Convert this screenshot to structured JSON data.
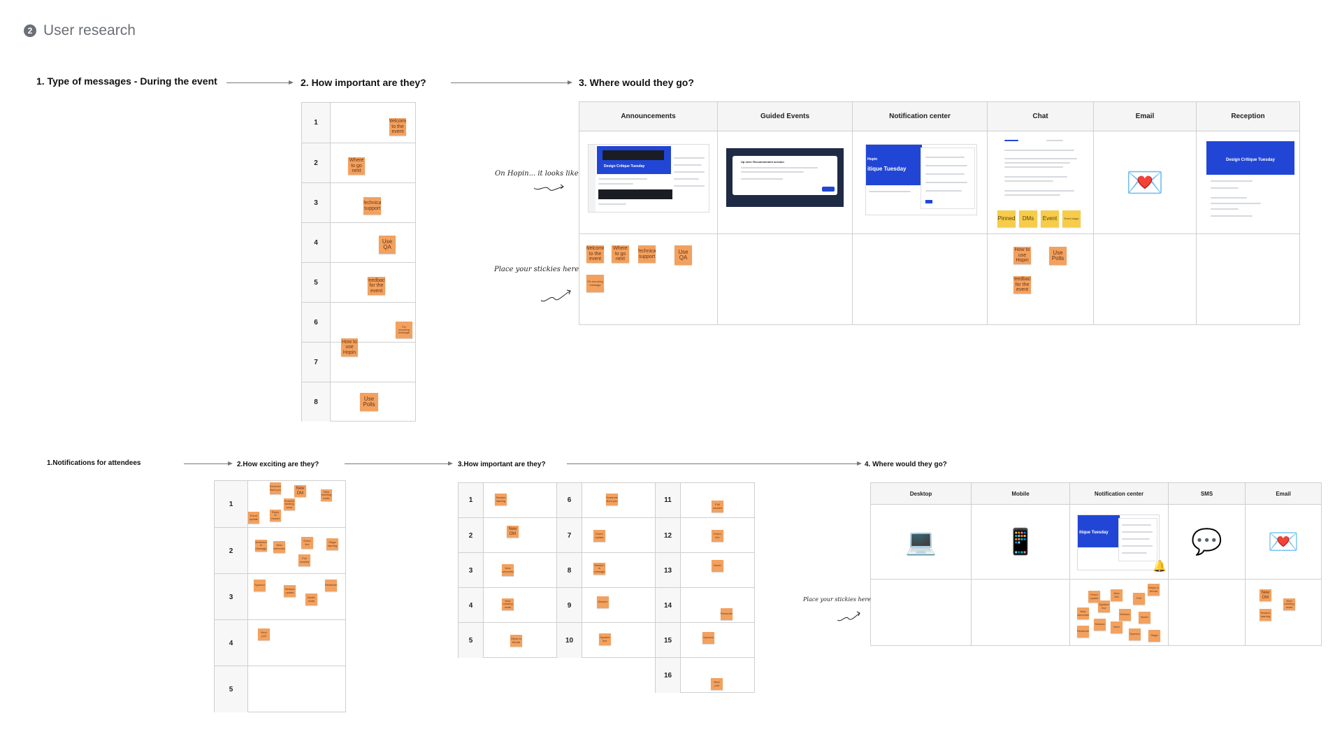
{
  "page": {
    "title": "User research",
    "step_icon": "2"
  },
  "section1": {
    "heading1": "1. Type of messages - During the event",
    "heading2": "2. How important are they?",
    "heading3": "3. Where would they go?",
    "ranks": [
      "1",
      "2",
      "3",
      "4",
      "5",
      "6",
      "7",
      "8"
    ],
    "ranked_stickies": [
      "Welcome to the event",
      "Where to go next",
      "Technical support",
      "Use QA",
      "Feedback for the event",
      "Fix recurring message",
      "How to use Hopin",
      "Use Polls"
    ],
    "columns": [
      "Announcements",
      "Guided Events",
      "Notification center",
      "Chat",
      "Email",
      "Reception"
    ],
    "row_labels": [
      "On Hopin... it looks like",
      "Place your stickies here"
    ],
    "announcements_stickies": [
      "Welcome to the event",
      "Where to go next",
      "Technical support",
      "Use QA",
      "Fix recurring message"
    ],
    "chat_stickies": [
      "How to use Hopin",
      "Use Polls",
      "Feedback for the event"
    ],
    "chat_tags": [
      "Pinned",
      "DMs",
      "Event",
      "Event stage"
    ],
    "mock_texts": {
      "design_critique": "Design Critique Tuesday",
      "hopin": "Hopin",
      "itique": "itique Tuesday",
      "up_next": "Up next: Recommended session"
    },
    "email_icon": "love-letter-icon"
  },
  "section2": {
    "heading1": "1.Notifications for attendees",
    "heading2": "2.How exciting are they?",
    "heading3": "3.How important are they?",
    "heading4": "4. Where would they go?",
    "exciting_ranks": [
      "1",
      "2",
      "3",
      "4",
      "5"
    ],
    "important_ranks": [
      "1",
      "2",
      "3",
      "4",
      "5",
      "6",
      "7",
      "8",
      "9",
      "10",
      "11",
      "12",
      "13",
      "14",
      "15",
      "16"
    ],
    "dm_sticky": "New DM",
    "exciting_stickies": [
      "Someone liked you",
      "New DM",
      "New meeting invite",
      "Session starting soon",
      "Event update",
      "Reply to thread",
      "Mentioned in message",
      "New connection",
      "Event live",
      "Stage starting",
      "Poll created",
      "Sponsor",
      "Session update",
      "Reminder",
      "Booth invite",
      "Next poll"
    ],
    "important_stickies": [
      "Session starting",
      "Someone liked you",
      "New DM",
      "New connection",
      "New meeting invite",
      "Reply to thread",
      "Event update",
      "Mention in message",
      "Session",
      "Speaker live",
      "Poll created",
      "Event live",
      "Booth",
      "Reminder",
      "Sponsor",
      "Next poll"
    ],
    "columns": [
      "Desktop",
      "Mobile",
      "Notification center",
      "SMS",
      "Email"
    ],
    "row_label": "Place your stickies here",
    "icons": [
      "laptop-icon",
      "mobile-phone-icon",
      "notification-center-screenshot",
      "speech-bubble-icon",
      "love-letter-icon"
    ],
    "email_stickies": [
      "New DM",
      "New meeting invite",
      "Session starting"
    ],
    "notif_stickies": [
      "Reply to thread",
      "Event update",
      "New DM",
      "Poll",
      "Speaker live",
      "New connection",
      "Mention",
      "Booth",
      "Session",
      "Next",
      "Reminder",
      "Sponsor",
      "Stage"
    ],
    "bell": "🔔"
  }
}
